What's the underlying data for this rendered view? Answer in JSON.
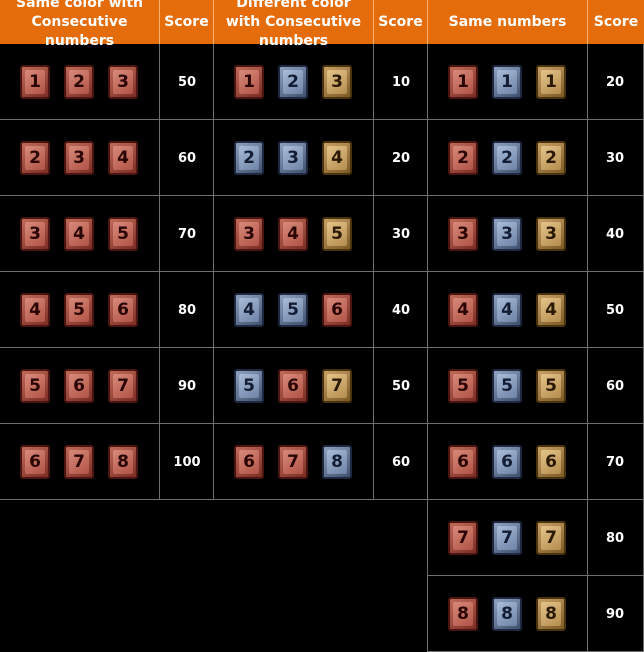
{
  "headers": {
    "same_color": "Same color with Consecutive numbers",
    "score1": "Score",
    "diff_color": "Different color with Consecutive numbers",
    "score2": "Score",
    "same_numbers": "Same numbers",
    "score3": "Score"
  },
  "colors": {
    "header_bg": "#e46c0a",
    "red": "#b05346",
    "blue": "#6d83a6",
    "yellow": "#b48c4e"
  },
  "table1": [
    {
      "tiles": [
        {
          "n": "1",
          "c": "red"
        },
        {
          "n": "2",
          "c": "red"
        },
        {
          "n": "3",
          "c": "red"
        }
      ],
      "score": "50"
    },
    {
      "tiles": [
        {
          "n": "2",
          "c": "red"
        },
        {
          "n": "3",
          "c": "red"
        },
        {
          "n": "4",
          "c": "red"
        }
      ],
      "score": "60"
    },
    {
      "tiles": [
        {
          "n": "3",
          "c": "red"
        },
        {
          "n": "4",
          "c": "red"
        },
        {
          "n": "5",
          "c": "red"
        }
      ],
      "score": "70"
    },
    {
      "tiles": [
        {
          "n": "4",
          "c": "red"
        },
        {
          "n": "5",
          "c": "red"
        },
        {
          "n": "6",
          "c": "red"
        }
      ],
      "score": "80"
    },
    {
      "tiles": [
        {
          "n": "5",
          "c": "red"
        },
        {
          "n": "6",
          "c": "red"
        },
        {
          "n": "7",
          "c": "red"
        }
      ],
      "score": "90"
    },
    {
      "tiles": [
        {
          "n": "6",
          "c": "red"
        },
        {
          "n": "7",
          "c": "red"
        },
        {
          "n": "8",
          "c": "red"
        }
      ],
      "score": "100"
    }
  ],
  "table2": [
    {
      "tiles": [
        {
          "n": "1",
          "c": "red"
        },
        {
          "n": "2",
          "c": "blue"
        },
        {
          "n": "3",
          "c": "yellow"
        }
      ],
      "score": "10"
    },
    {
      "tiles": [
        {
          "n": "2",
          "c": "blue"
        },
        {
          "n": "3",
          "c": "blue"
        },
        {
          "n": "4",
          "c": "yellow"
        }
      ],
      "score": "20"
    },
    {
      "tiles": [
        {
          "n": "3",
          "c": "red"
        },
        {
          "n": "4",
          "c": "red"
        },
        {
          "n": "5",
          "c": "yellow"
        }
      ],
      "score": "30"
    },
    {
      "tiles": [
        {
          "n": "4",
          "c": "blue"
        },
        {
          "n": "5",
          "c": "blue"
        },
        {
          "n": "6",
          "c": "red"
        }
      ],
      "score": "40"
    },
    {
      "tiles": [
        {
          "n": "5",
          "c": "blue"
        },
        {
          "n": "6",
          "c": "red"
        },
        {
          "n": "7",
          "c": "yellow"
        }
      ],
      "score": "50"
    },
    {
      "tiles": [
        {
          "n": "6",
          "c": "red"
        },
        {
          "n": "7",
          "c": "red"
        },
        {
          "n": "8",
          "c": "blue"
        }
      ],
      "score": "60"
    }
  ],
  "table3": [
    {
      "tiles": [
        {
          "n": "1",
          "c": "red"
        },
        {
          "n": "1",
          "c": "blue"
        },
        {
          "n": "1",
          "c": "yellow"
        }
      ],
      "score": "20"
    },
    {
      "tiles": [
        {
          "n": "2",
          "c": "red"
        },
        {
          "n": "2",
          "c": "blue"
        },
        {
          "n": "2",
          "c": "yellow"
        }
      ],
      "score": "30"
    },
    {
      "tiles": [
        {
          "n": "3",
          "c": "red"
        },
        {
          "n": "3",
          "c": "blue"
        },
        {
          "n": "3",
          "c": "yellow"
        }
      ],
      "score": "40"
    },
    {
      "tiles": [
        {
          "n": "4",
          "c": "red"
        },
        {
          "n": "4",
          "c": "blue"
        },
        {
          "n": "4",
          "c": "yellow"
        }
      ],
      "score": "50"
    },
    {
      "tiles": [
        {
          "n": "5",
          "c": "red"
        },
        {
          "n": "5",
          "c": "blue"
        },
        {
          "n": "5",
          "c": "yellow"
        }
      ],
      "score": "60"
    },
    {
      "tiles": [
        {
          "n": "6",
          "c": "red"
        },
        {
          "n": "6",
          "c": "blue"
        },
        {
          "n": "6",
          "c": "yellow"
        }
      ],
      "score": "70"
    },
    {
      "tiles": [
        {
          "n": "7",
          "c": "red"
        },
        {
          "n": "7",
          "c": "blue"
        },
        {
          "n": "7",
          "c": "yellow"
        }
      ],
      "score": "80"
    },
    {
      "tiles": [
        {
          "n": "8",
          "c": "red"
        },
        {
          "n": "8",
          "c": "blue"
        },
        {
          "n": "8",
          "c": "yellow"
        }
      ],
      "score": "90"
    }
  ]
}
